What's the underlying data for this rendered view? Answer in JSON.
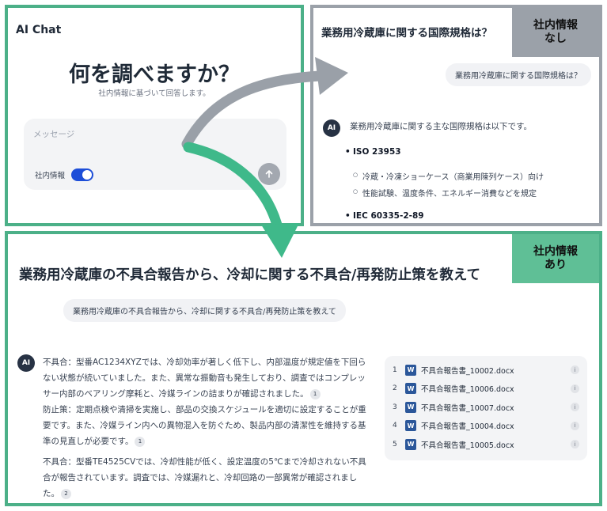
{
  "panel1": {
    "app_title": "AI Chat",
    "heading": "何を調べますか？",
    "subheading": "社内情報に基づいて回答します。",
    "message_placeholder": "メッセージ",
    "toggle_label": "社内情報",
    "toggle_on": true
  },
  "panel2": {
    "badge_line1": "社内情報",
    "badge_line2": "なし",
    "question_title": "業務用冷蔵庫に関する国際規格は？",
    "user_chip": "業務用冷蔵庫に関する国際規格は？",
    "ai_label": "AI",
    "answer_intro": "業務用冷蔵庫に関する主な国際規格は以下です。",
    "standards": [
      {
        "name": "ISO 23953",
        "details": [
          "冷蔵・冷凍ショーケース（商業用陳列ケース）向け",
          "性能試験、温度条件、エネルギー消費などを規定"
        ]
      },
      {
        "name": "IEC 60335-2-89",
        "details": []
      }
    ]
  },
  "panel3": {
    "badge_line1": "社内情報",
    "badge_line2": "あり",
    "question_title": "業務用冷蔵庫の不具合報告から、冷却に関する不具合/再発防止策を教えて",
    "user_chip": "業務用冷蔵庫の不具合報告から、冷却に関する不具合/再発防止策を教えて",
    "ai_label": "AI",
    "answer_blocks": [
      {
        "issue": "不具合：型番AC1234XYZでは、冷却効率が著しく低下し、内部温度が規定値を下回らない状態が続いていました。また、異常な振動音も発生しており、調査ではコンプレッサー内部のベアリング摩耗と、冷媒ラインの詰まりが確認されました。",
        "issue_cite": "1",
        "fix": "防止策：定期点検や清掃を実施し、部品の交換スケジュールを適切に設定することが重要です。また、冷媒ライン内への異物混入を防ぐため、製品内部の清潔性を維持する基準の見直しが必要です。",
        "fix_cite": "1"
      },
      {
        "issue": "不具合：型番TE4525CVでは、冷却性能が低く、設定温度の5℃まで冷却されない不具合が報告されています。調査では、冷媒漏れと、冷却回路の一部異常が確認されました。",
        "issue_cite": "2"
      }
    ],
    "references": [
      {
        "num": "1",
        "icon": "W",
        "name": "不具合報告書_10002.docx",
        "info": "i"
      },
      {
        "num": "2",
        "icon": "W",
        "name": "不具合報告書_10006.docx",
        "info": "i"
      },
      {
        "num": "3",
        "icon": "W",
        "name": "不具合報告書_10007.docx",
        "info": "i"
      },
      {
        "num": "4",
        "icon": "W",
        "name": "不具合報告書_10004.docx",
        "info": "i"
      },
      {
        "num": "5",
        "icon": "W",
        "name": "不具合報告書_10005.docx",
        "info": "i"
      }
    ]
  },
  "colors": {
    "green_frame": "#4cb088",
    "gray_frame": "#9ba1a9",
    "toggle_blue": "#1d4ed8",
    "arrow_gray": "#9aa0a8",
    "arrow_green": "#3fb98a"
  }
}
